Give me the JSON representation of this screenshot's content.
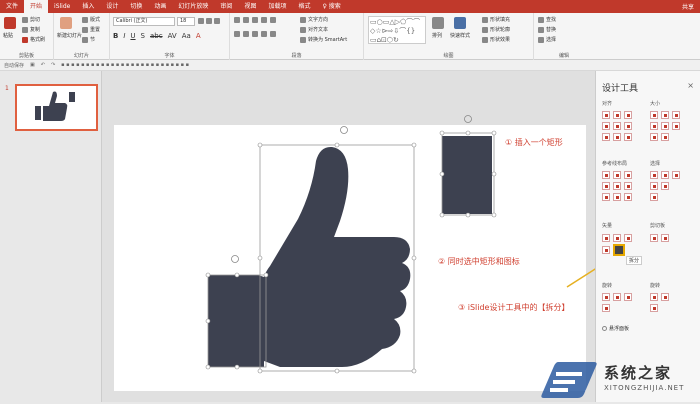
{
  "menu": {
    "tabs": [
      "文件",
      "开始",
      "iSlide",
      "插入",
      "设计",
      "切换",
      "动画",
      "幻灯片放映",
      "审阅",
      "视图",
      "加载项",
      "格式"
    ],
    "active_tab": "开始",
    "tell_me": "♀ 搜索",
    "share": "共享"
  },
  "ribbon": {
    "clipboard": {
      "label": "剪贴板",
      "paste": "粘贴",
      "cut": "剪切",
      "copy": "复制",
      "format_painter": "格式刷"
    },
    "slides": {
      "label": "幻灯片",
      "new_slide": "新建幻灯片",
      "layout": "版式",
      "reset": "重置",
      "section": "节"
    },
    "font": {
      "label": "字体",
      "font_name": "Calibri (正文)",
      "font_size": "18"
    },
    "paragraph": {
      "label": "段落",
      "text_direction": "文字方向",
      "align_text": "对齐文本",
      "smartart": "转换为 SmartArt"
    },
    "drawing": {
      "label": "绘图",
      "arrange": "排列",
      "quick_styles": "快速样式",
      "shape_fill": "形状填充",
      "shape_outline": "形状轮廓",
      "shape_effects": "形状效果"
    },
    "editing": {
      "label": "编辑",
      "find": "查找",
      "replace": "替换",
      "select": "选择"
    }
  },
  "qat": {
    "label": "自动保存"
  },
  "slides_pane": {
    "slide_number": "1"
  },
  "panel": {
    "title": "设计工具",
    "close": "×",
    "sections": {
      "align": "对齐",
      "size": "大小",
      "guides": "参考线布局",
      "select": "选择",
      "vector": "矢量",
      "clip": "剪切板",
      "rotate_left": "旋转",
      "rotate_right": "旋转"
    },
    "split_tooltip": "拆分",
    "float_label": "悬浮面板"
  },
  "annotations": {
    "a1": "① 插入一个矩形",
    "a2": "② 同时选中矩形和图标",
    "a3": "③ iSlide设计工具中的【拆分】"
  },
  "watermark": {
    "name": "系统之家",
    "url": "XITONGZHIJIA.NET"
  },
  "colors": {
    "accent": "#c0392b",
    "shape": "#3d4150",
    "annotation": "#d04030"
  }
}
